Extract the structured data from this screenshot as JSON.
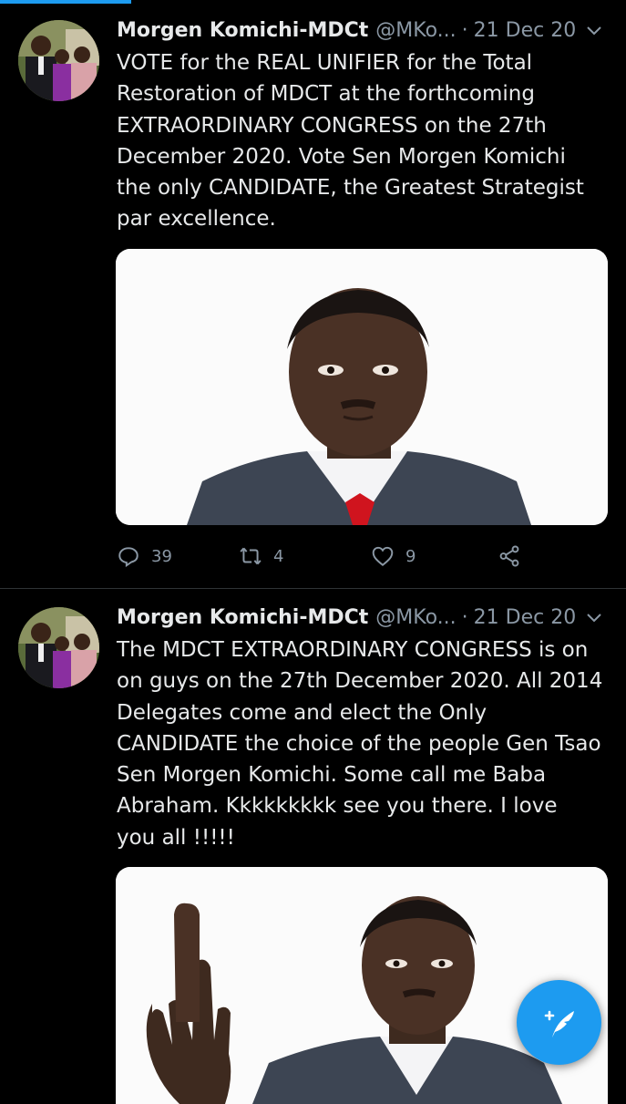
{
  "progress": 0.21,
  "colors": {
    "accent": "#1d9bf0",
    "background": "#000000",
    "text": "#e7e9ea",
    "muted": "#8b98a5"
  },
  "tweets": [
    {
      "author_name": "Morgen Komichi-MDCt",
      "handle": "@MKo...",
      "separator": "·",
      "date": "21 Dec 20",
      "text_lines": [
        "VOTE for the REAL UNIFIER for the Total",
        "Restoration of MDCT at the forthcoming",
        "EXTRAORDINARY CONGRESS on the 27th",
        "December 2020. Vote Sen Morgen Komichi",
        "the only CANDIDATE, the  Greatest Strategist",
        "par excellence."
      ],
      "replies": "39",
      "retweets": "4",
      "likes": "9"
    },
    {
      "author_name": "Morgen Komichi-MDCt",
      "handle": "@MKo...",
      "separator": "·",
      "date": "21 Dec 20",
      "text_lines": [
        "The MDCT EXTRAORDINARY CONGRESS is on",
        "on guys on the 27th December 2020. All 2014",
        "Delegates come and elect the Only",
        "CANDIDATE the choice of the people Gen Tsao",
        "Sen Morgen Komichi. Some call me  Baba",
        "Abraham.  Kkkkkkkkk see you there.  I love",
        "you all !!!!!"
      ]
    }
  ],
  "icons": {
    "caret": "chevron-down-icon",
    "reply": "reply-icon",
    "retweet": "retweet-icon",
    "like": "heart-icon",
    "share": "share-icon",
    "compose": "compose-tweet-icon"
  }
}
